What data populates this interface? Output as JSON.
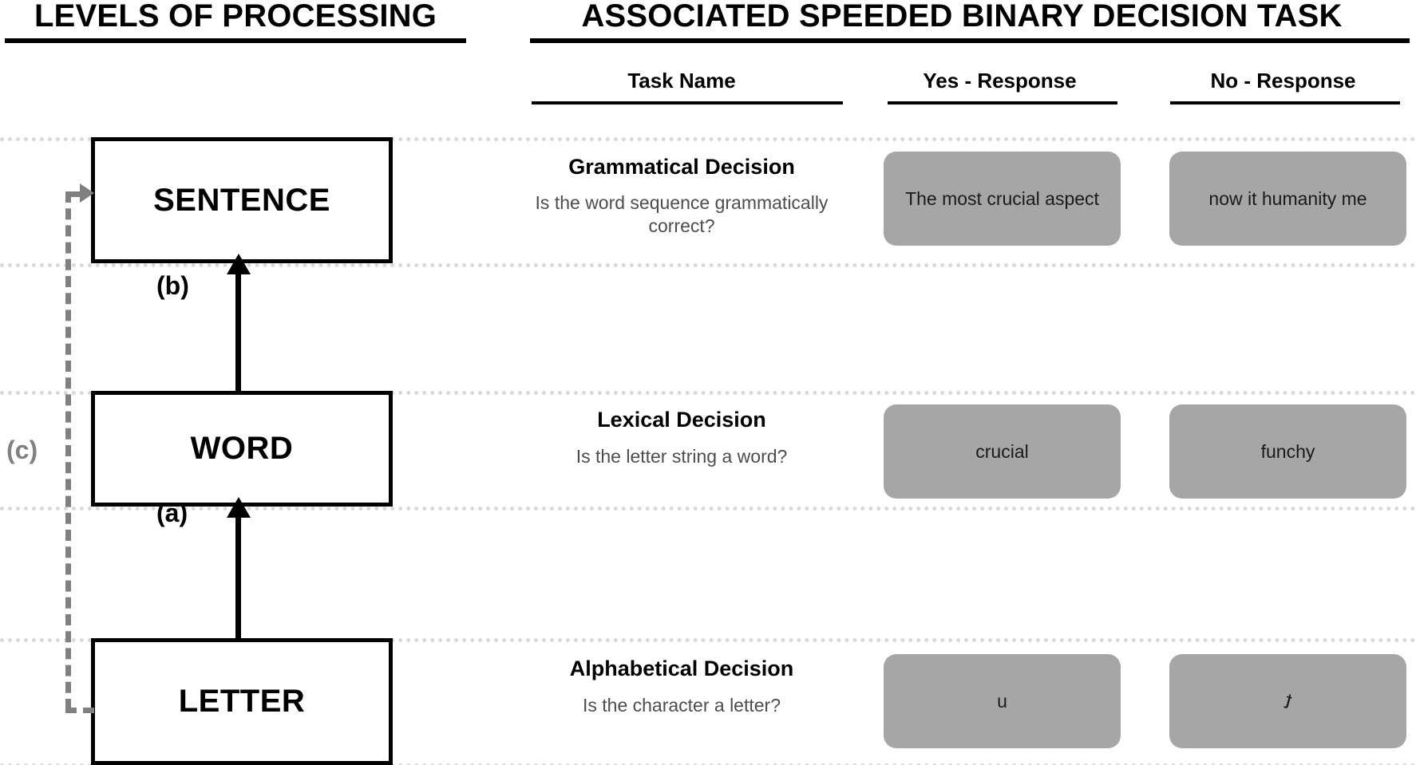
{
  "headers": {
    "left_title": "LEVELS OF PROCESSING",
    "right_title": "ASSOCIATED SPEEDED BINARY DECISION TASK"
  },
  "columns": {
    "task_name": "Task Name",
    "yes_response": "Yes - Response",
    "no_response": "No - Response"
  },
  "levels": [
    {
      "label": "SENTENCE"
    },
    {
      "label": "WORD"
    },
    {
      "label": "LETTER"
    }
  ],
  "arrows": {
    "letter_to_word": "(a)",
    "word_to_sentence": "(b)",
    "feedback": "(c)"
  },
  "rows": [
    {
      "task_name": "Grammatical Decision",
      "question": "Is the word sequence grammatically correct?",
      "yes_example": "The most crucial aspect",
      "no_example": "now it humanity me"
    },
    {
      "task_name": "Lexical Decision",
      "question": "Is the letter string a word?",
      "yes_example": "crucial",
      "no_example": "funchy"
    },
    {
      "task_name": "Alphabetical Decision",
      "question": "Is the character a letter?",
      "yes_example": "u",
      "no_example": "ʇ"
    }
  ],
  "colors": {
    "chip_fill": "#a6a6a6",
    "box_border": "#000000",
    "separator": "#d9d9d9",
    "feedback_arrow": "#808080",
    "question_text": "#4d4d4d"
  }
}
